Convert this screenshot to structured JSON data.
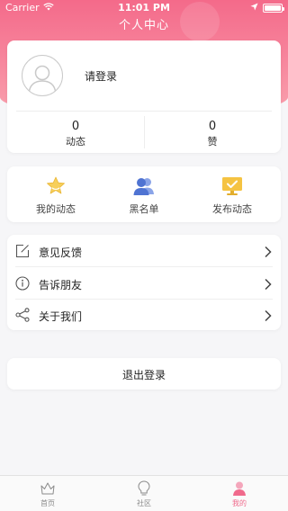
{
  "status_bar": {
    "carrier": "Carrier",
    "time": "11:01 PM"
  },
  "nav": {
    "title": "个人中心"
  },
  "profile": {
    "login_prompt": "请登录",
    "stats": [
      {
        "value": "0",
        "label": "动态"
      },
      {
        "value": "0",
        "label": "赞"
      }
    ]
  },
  "quick_actions": [
    {
      "label": "我的动态",
      "icon": "star-icon"
    },
    {
      "label": "黑名单",
      "icon": "users-icon"
    },
    {
      "label": "发布动态",
      "icon": "monitor-check-icon"
    }
  ],
  "menu": [
    {
      "label": "意见反馈",
      "icon": "edit-icon"
    },
    {
      "label": "告诉朋友",
      "icon": "info-icon"
    },
    {
      "label": "关于我们",
      "icon": "share-icon"
    }
  ],
  "logout": {
    "label": "退出登录"
  },
  "tabs": [
    {
      "label": "首页",
      "icon": "crown-icon",
      "active": false
    },
    {
      "label": "社区",
      "icon": "bulb-icon",
      "active": false
    },
    {
      "label": "我的",
      "icon": "person-icon",
      "active": true
    }
  ],
  "colors": {
    "accent": "#f06a8c",
    "header_top": "#f46a8a",
    "header_bottom": "#f9a2ae",
    "star": "#f5c342",
    "users": "#5b7fd6"
  }
}
